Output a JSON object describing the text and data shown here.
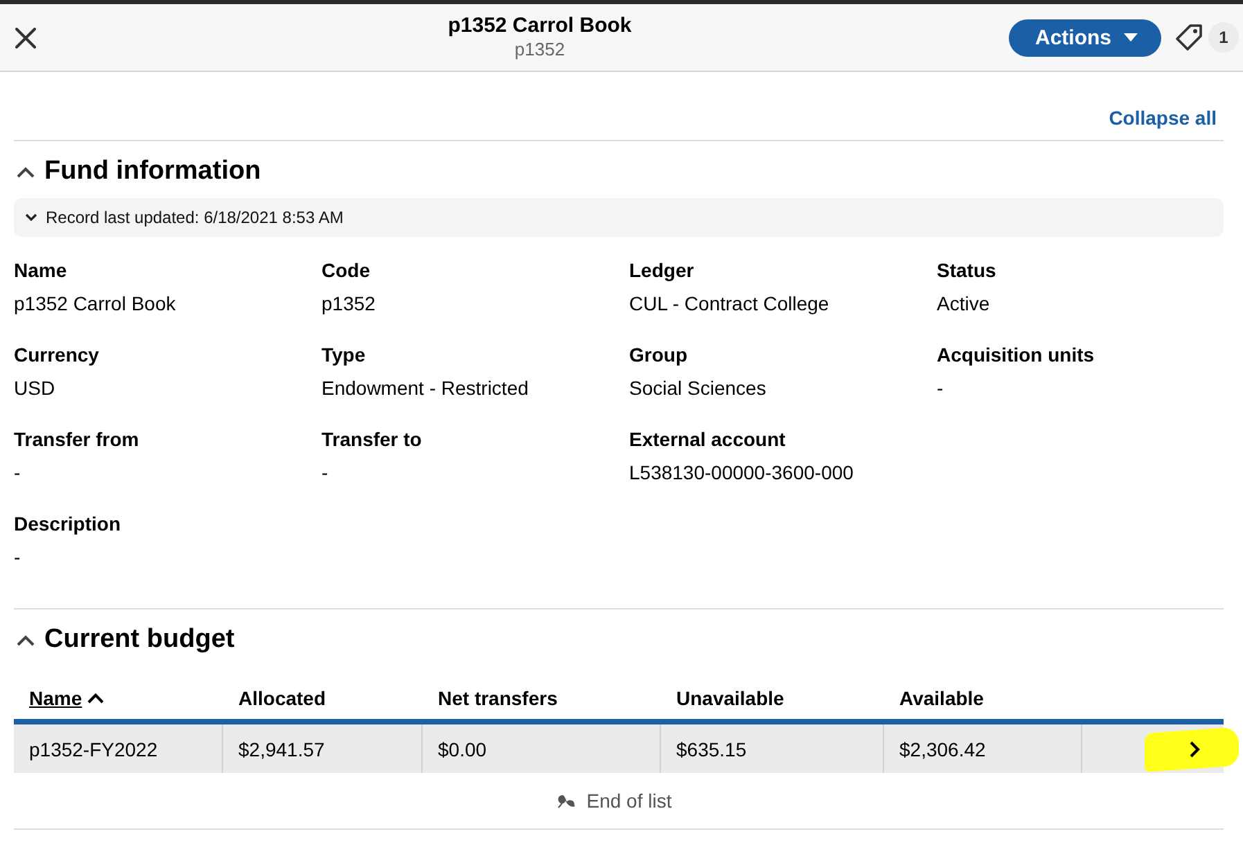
{
  "header": {
    "title": "p1352 Carrol Book",
    "subtitle": "p1352",
    "actions_button": "Actions",
    "tag_count": "1"
  },
  "collapse_all": "Collapse all",
  "fund_information": {
    "title": "Fund information",
    "expanded": true,
    "record_updated": {
      "label": "Record last updated: 6/18/2021 8:53 AM",
      "expanded": false
    },
    "field_rows": [
      [
        {
          "label": "Name",
          "value": "p1352 Carrol Book"
        },
        {
          "label": "Code",
          "value": "p1352"
        },
        {
          "label": "Ledger",
          "value": "CUL - Contract College"
        },
        {
          "label": "Status",
          "value": "Active"
        }
      ],
      [
        {
          "label": "Currency",
          "value": "USD"
        },
        {
          "label": "Type",
          "value": "Endowment - Restricted"
        },
        {
          "label": "Group",
          "value": "Social Sciences"
        },
        {
          "label": "Acquisition units",
          "value": "-"
        }
      ],
      [
        {
          "label": "Transfer from",
          "value": "-"
        },
        {
          "label": "Transfer to",
          "value": "-"
        },
        {
          "label": "External account",
          "value": "L538130-00000-3600-000"
        }
      ],
      [
        {
          "label": "Description",
          "value": "-"
        }
      ]
    ]
  },
  "current_budget": {
    "title": "Current budget",
    "expanded": true,
    "table": {
      "columns": [
        {
          "label": "Name",
          "sorted": true
        },
        {
          "label": "Allocated",
          "sorted": false
        },
        {
          "label": "Net transfers",
          "sorted": false
        },
        {
          "label": "Unavailable",
          "sorted": false
        },
        {
          "label": "Available",
          "sorted": false
        }
      ],
      "rows": [
        {
          "cells": [
            "p1352-FY2022",
            "$2,941.57",
            "$0.00",
            "$635.15",
            "$2,306.42"
          ],
          "highlighted": true
        }
      ]
    },
    "end_of_list": "End of list"
  }
}
